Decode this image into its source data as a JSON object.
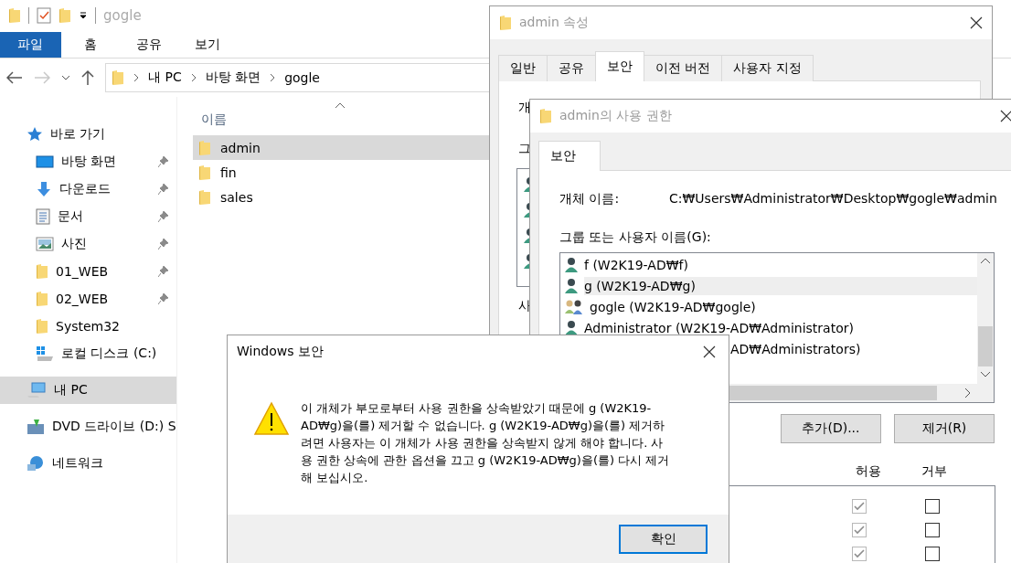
{
  "explorer": {
    "title": "gogle",
    "ribbon_tabs": [
      {
        "label": "파일",
        "selected": true
      },
      {
        "label": "홈",
        "selected": false
      },
      {
        "label": "공유",
        "selected": false
      },
      {
        "label": "보기",
        "selected": false
      }
    ],
    "nav": {
      "forward_disabled": true
    },
    "breadcrumbs": [
      "내 PC",
      "바탕 화면",
      "gogle"
    ],
    "column_header": "이름",
    "files": [
      {
        "name": "admin",
        "selected": true
      },
      {
        "name": "fin",
        "selected": false
      },
      {
        "name": "sales",
        "selected": false
      }
    ],
    "sidebar": [
      {
        "label": "바로 가기",
        "kind": "star",
        "selected": false,
        "children": [
          {
            "label": "바탕 화면",
            "kind": "desktop",
            "pinned": true,
            "selected": false
          },
          {
            "label": "다운로드",
            "kind": "download",
            "pinned": true,
            "selected": false
          },
          {
            "label": "문서",
            "kind": "document",
            "pinned": true,
            "selected": false
          },
          {
            "label": "사진",
            "kind": "picture",
            "pinned": true,
            "selected": false
          },
          {
            "label": "01_WEB",
            "kind": "folder",
            "pinned": true,
            "selected": false
          },
          {
            "label": "02_WEB",
            "kind": "folder",
            "pinned": true,
            "selected": false
          },
          {
            "label": "System32",
            "kind": "folder",
            "pinned": false,
            "selected": false
          },
          {
            "label": "로컬 디스크 (C:)",
            "kind": "drive",
            "pinned": false,
            "selected": false
          }
        ]
      },
      {
        "label": "내 PC",
        "kind": "pc",
        "selected": true
      },
      {
        "label": "DVD 드라이브 (D:) S",
        "kind": "dvd",
        "selected": false
      },
      {
        "label": "네트워크",
        "kind": "network",
        "selected": false
      }
    ]
  },
  "properties": {
    "title": "admin 속성",
    "tabs": [
      {
        "label": "일반",
        "selected": false
      },
      {
        "label": "공유",
        "selected": false
      },
      {
        "label": "보안",
        "selected": true
      },
      {
        "label": "이전 버전",
        "selected": false
      },
      {
        "label": "사용자 지정",
        "selected": false
      }
    ],
    "fragments": [
      "개",
      "그",
      "사"
    ]
  },
  "permissions": {
    "title": "admin의 사용 권한",
    "tabs": [
      {
        "label": "보안",
        "selected": true
      }
    ],
    "object_label": "개체 이름:",
    "object_path": "C:₩Users₩Administrator₩Desktop₩gogle₩admin",
    "users_label": "그룹 또는 사용자 이름(G):",
    "users": [
      {
        "name": "f (W2K19-AD₩f)",
        "kind": "user",
        "selected": false
      },
      {
        "name": "g (W2K19-AD₩g)",
        "kind": "user",
        "selected": true
      },
      {
        "name": "gogle (W2K19-AD₩gogle)",
        "kind": "group",
        "selected": false
      },
      {
        "name": "Administrator (W2K19-AD₩Administrator)",
        "kind": "user",
        "selected": false
      },
      {
        "name": "AD₩Administrators)",
        "kind": "partial",
        "selected": false
      }
    ],
    "buttons": [
      "추가(D)...",
      "제거(R)"
    ],
    "columns": [
      "허용",
      "거부"
    ],
    "rights": [
      {
        "allow": true,
        "deny": false
      },
      {
        "allow": true,
        "deny": false
      },
      {
        "allow": true,
        "deny": false
      }
    ]
  },
  "alert": {
    "title": "Windows 보안",
    "message": "이 개체가 부모로부터 사용 권한을 상속받았기 때문에 g (W2K19-AD₩g)을(를) 제거할 수 없습니다. g (W2K19-AD₩g)을(를) 제거하려면 사용자는 이 개체가 사용 권한을 상속받지 않게 해야 합니다. 사용 권한 상속에 관한 옵션을 끄고 g (W2K19-AD₩g)을(를) 다시 제거해 보십시오.",
    "button": "확인"
  }
}
